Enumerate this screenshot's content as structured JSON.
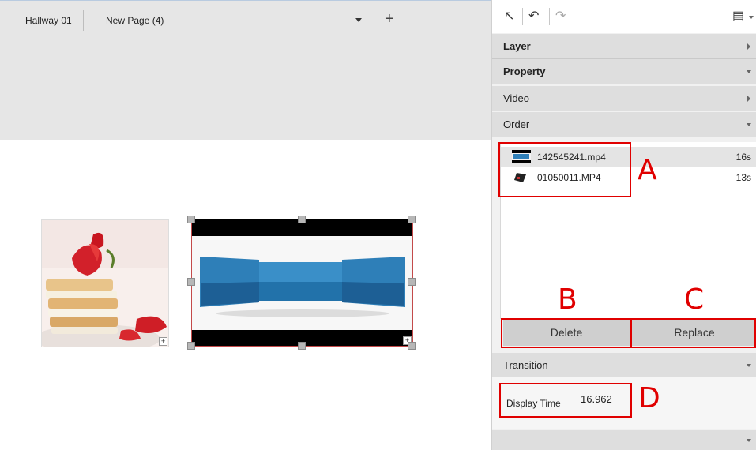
{
  "header": {
    "tabs": [
      "Hallway 01",
      "New Page (4)"
    ]
  },
  "panel": {
    "sections": {
      "layer": "Layer",
      "property": "Property",
      "video": "Video",
      "order": "Order",
      "transition": "Transition"
    },
    "order_items": [
      {
        "name": "142545241.mp4",
        "duration": "16s",
        "selected": true
      },
      {
        "name": "01050011.MP4",
        "duration": "13s",
        "selected": false
      }
    ],
    "buttons": {
      "delete": "Delete",
      "replace": "Replace"
    },
    "display_time": {
      "label": "Display Time",
      "value": "16.962"
    }
  },
  "annotations": {
    "a": "A",
    "b": "B",
    "c": "C",
    "d": "D",
    "color": "#e00000"
  }
}
